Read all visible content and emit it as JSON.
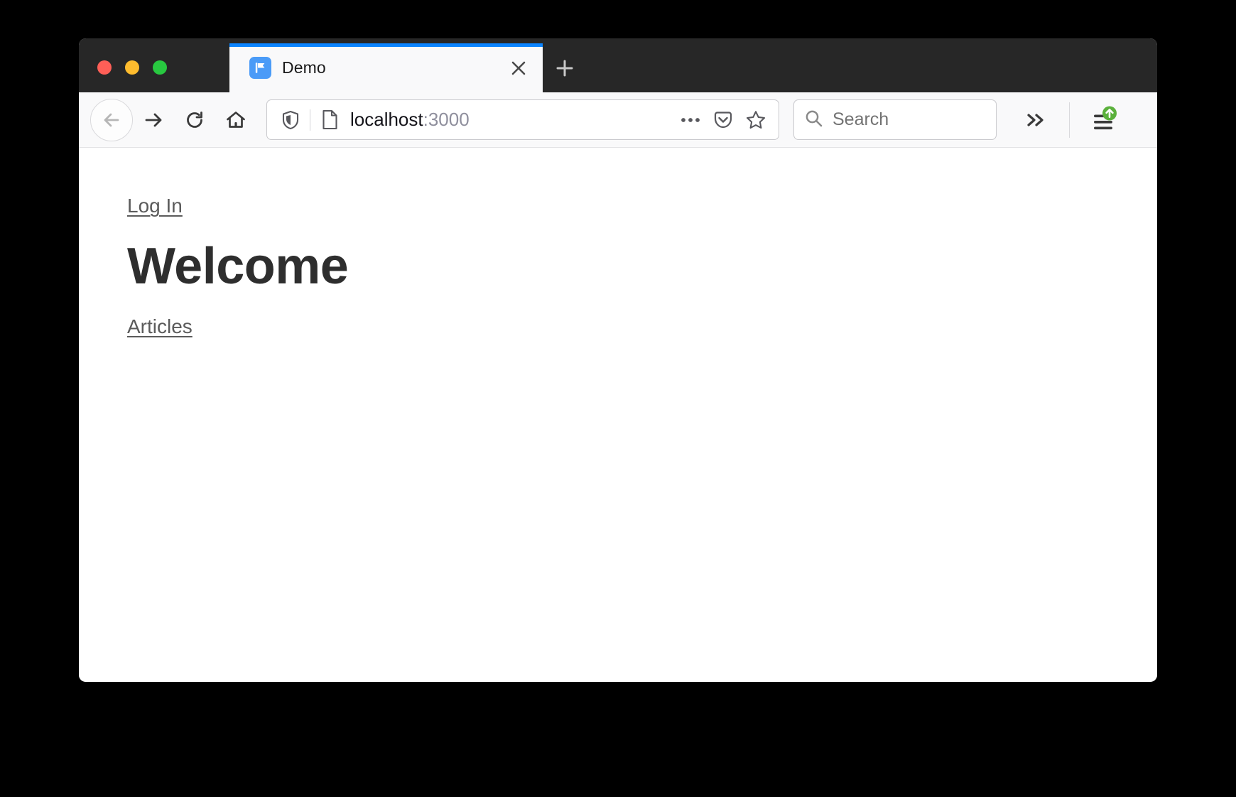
{
  "window": {
    "controls": [
      {
        "name": "close",
        "color": "#FF5F57"
      },
      {
        "name": "minimize",
        "color": "#FEBC2E"
      },
      {
        "name": "maximize",
        "color": "#28C840"
      }
    ]
  },
  "tabs": {
    "active_index": 0,
    "items": [
      {
        "title": "Demo",
        "favicon": "flag-icon",
        "close_label": "✕"
      }
    ],
    "new_tab_label": "+"
  },
  "toolbar": {
    "back_label": "back-arrow-icon",
    "forward_label": "forward-arrow-icon",
    "reload_label": "reload-icon",
    "home_label": "home-icon",
    "overflow_label": "»",
    "menu_label": "hamburger-icon",
    "update_badge": "update-arrow-icon",
    "accent_color": "#0A84FF",
    "update_badge_color": "#5BB13C"
  },
  "urlbar": {
    "shield_icon": "shield-icon",
    "identity_icon": "page-document-icon",
    "host": "localhost",
    "port": ":3000",
    "page_actions_icon": "ellipsis-icon",
    "pocket_icon": "pocket-icon",
    "bookmark_icon": "star-icon"
  },
  "search": {
    "icon": "magnifier-icon",
    "placeholder": "Search",
    "value": ""
  },
  "page": {
    "login_link": "Log In",
    "heading": "Welcome",
    "articles_link": "Articles"
  }
}
